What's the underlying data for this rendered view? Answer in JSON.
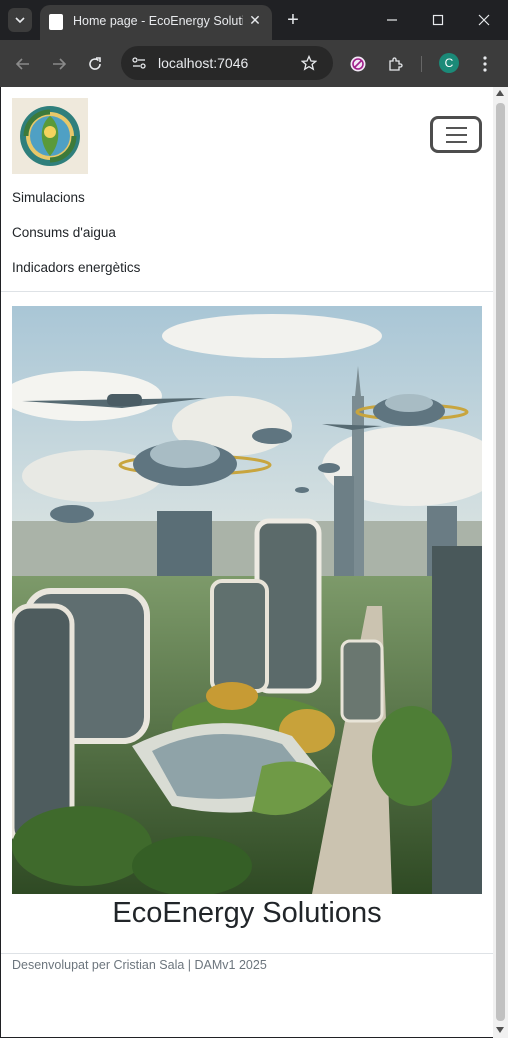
{
  "browser": {
    "tab_title": "Home page - EcoEnergy Solutio",
    "url": "localhost:7046",
    "profile_initial": "C"
  },
  "page": {
    "nav_items": [
      {
        "label": "Simulacions"
      },
      {
        "label": "Consums d'aigua"
      },
      {
        "label": "Indicadors energètics"
      }
    ],
    "title": "EcoEnergy Solutions",
    "footer": "Desenvolupat per Cristian Sala | DAMv1 2025"
  }
}
